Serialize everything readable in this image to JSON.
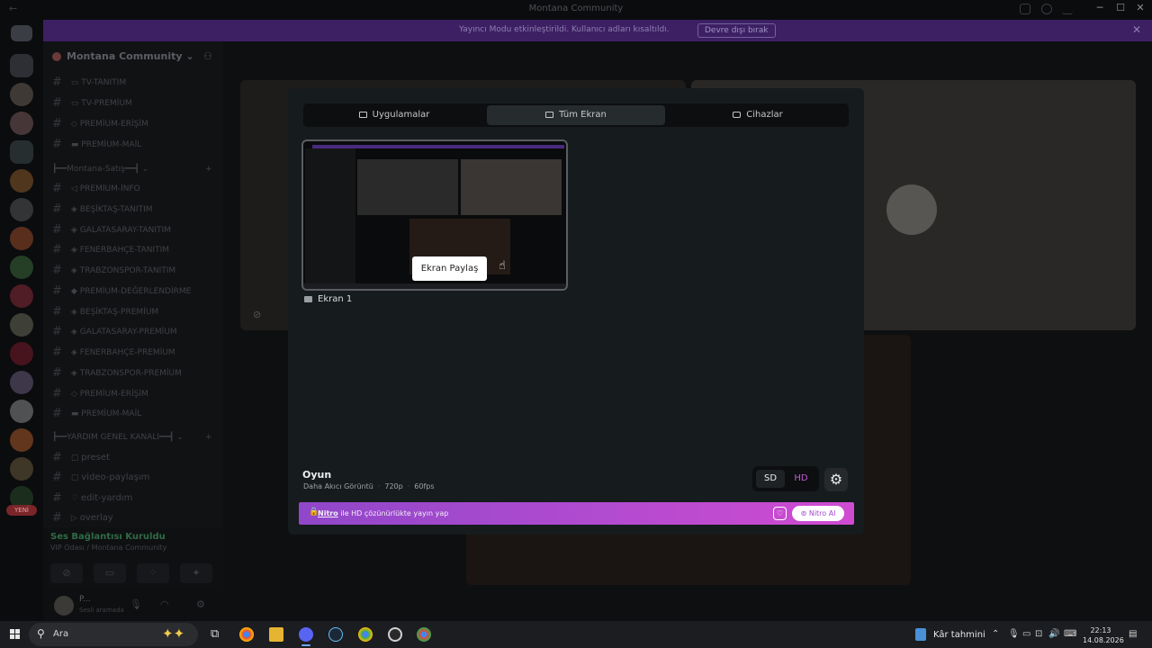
{
  "window": {
    "title": "Montana Community",
    "minimize": "─",
    "maximize": "☐",
    "close": "✕"
  },
  "banner": {
    "message": "Yayıncı Modu etkinleştirildi. Kullanıcı adları kısaltıldı.",
    "disable_button": "Devre dışı bırak",
    "close": "✕"
  },
  "rail": {
    "new_badge": "YENİ"
  },
  "sidebar": {
    "server_name": "Montana Community",
    "channels_top": [
      {
        "name": "TV-TANITIM"
      },
      {
        "name": "TV-PREMİUM"
      },
      {
        "name": "PREMİUM-ERİŞİM"
      },
      {
        "name": "PREMİUM-MAİL"
      }
    ],
    "category_1": "┣━━Montana-Satış━━┫",
    "channels_mid": [
      {
        "name": "PREMİUM-İNFO"
      },
      {
        "name": "BEŞİKTAŞ-TANITIM"
      },
      {
        "name": "GALATASARAY-TANITIM"
      },
      {
        "name": "FENERBAHÇE-TANITIM"
      },
      {
        "name": "TRABZONSPOR-TANITIM"
      },
      {
        "name": "PREMİUM-DEĞERLENDİRME"
      },
      {
        "name": "BEŞİKTAŞ-PREMİUM"
      },
      {
        "name": "GALATASARAY-PREMİUM"
      },
      {
        "name": "FENERBAHÇE-PREMİUM"
      },
      {
        "name": "TRABZONSPOR-PREMİUM"
      },
      {
        "name": "PREMİUM-ERİŞİM"
      },
      {
        "name": "PREMİUM-MAİL"
      }
    ],
    "category_2": "┣━━YARDIM GENEL KANALI━━┫",
    "channels_bottom": [
      {
        "name": "preset"
      },
      {
        "name": "video-paylaşım"
      },
      {
        "name": "edit-yardım"
      },
      {
        "name": "overlay"
      }
    ],
    "voice": {
      "status": "Ses Bağlantısı Kuruldu",
      "channel": "VIP Odası / Montana Community"
    },
    "user": {
      "name": "P...",
      "status": "Sesli aramada"
    }
  },
  "modal": {
    "tabs": [
      {
        "label": "Uygulamalar"
      },
      {
        "label": "Tüm Ekran"
      },
      {
        "label": "Cihazlar"
      }
    ],
    "share_button": "Ekran Paylaş",
    "screen_label": "Ekran 1",
    "quality": {
      "title": "Oyun",
      "subtitle": "Daha Akıcı Görüntü",
      "resolution": "720p",
      "fps": "60fps",
      "sd": "SD",
      "hd": "HD"
    },
    "nitro": {
      "brand": "Nitro",
      "text": "ile HD çözünürlükte yayın yap",
      "button": "Nitro Al"
    }
  },
  "taskbar": {
    "search_placeholder": "Ara",
    "weather": "Kâr tahmini",
    "time": "22:13",
    "date": "14.08.2026"
  },
  "colors": {
    "banner": "#3d2064",
    "modal": "#161b1d",
    "nitro_gradient_start": "#9047c9",
    "nitro_gradient_end": "#d04bd1",
    "hd_accent": "#c25ad6"
  }
}
